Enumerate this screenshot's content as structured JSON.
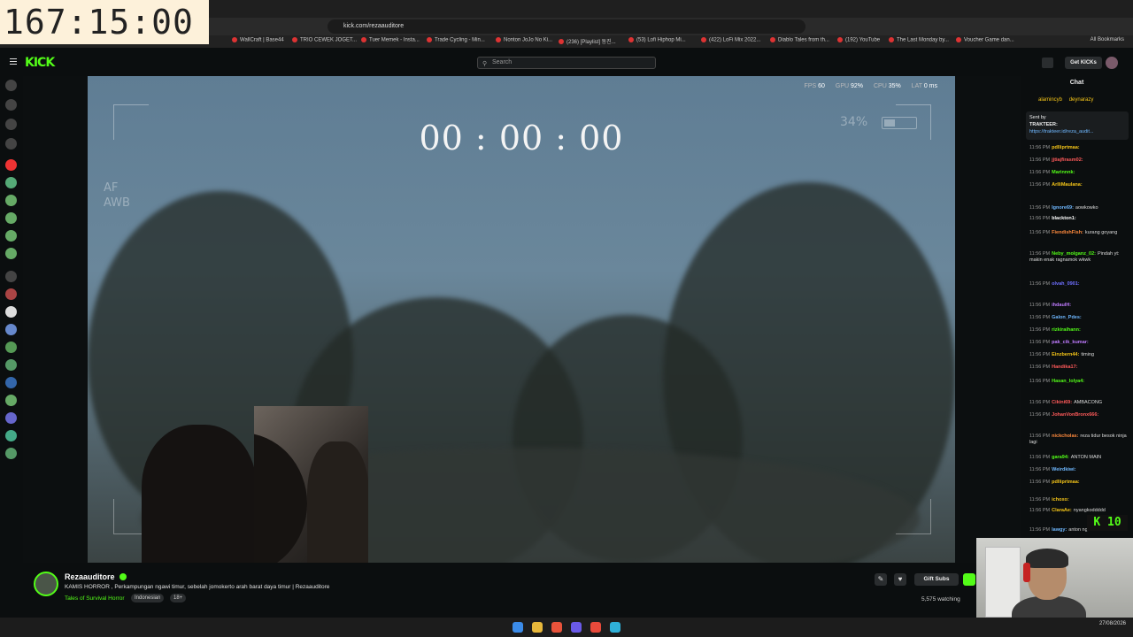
{
  "overlay_timer": "167:15:00",
  "browser": {
    "url": "kick.com/rezaauditore",
    "bookmarks": [
      "WallCraft | Base44",
      "TRIO CEWEK JOGET...",
      "Tuer Memek - Insta...",
      "Trade Cycling - Min...",
      "Nonton JoJo No Ki...",
      "(236) [Playlist] 동진...",
      "(53) Lofi Hiphop Mi...",
      "(422) LoFi Mix 2022...",
      "Diablo Tales from th...",
      "(192) YouTube",
      "The Last Monday by...",
      "Voucher Game dan..."
    ],
    "all_bookmarks": "All Bookmarks"
  },
  "header": {
    "logo": "KICK",
    "search_placeholder": "Search",
    "get_kicks": "Get KICKs"
  },
  "video": {
    "stream_timer": "00 : 00 : 00",
    "af_label": "AF",
    "awb_label": "AWB",
    "battery": "34%",
    "perf": {
      "fps_label": "FPS",
      "fps": "60",
      "gpu_label": "GPU",
      "gpu": "92%",
      "cpu_label": "CPU",
      "cpu": "35%",
      "lat_label": "LAT",
      "lat": "0 ms"
    }
  },
  "stream": {
    "streamer": "Rezaauditore",
    "title": "KAMIS HORROR , Perkampungan ngawi timur, sebelah jomokerto arah barat daya timur | Rezaauditore",
    "category": "Tales of Survival Horror",
    "tags": [
      "Indonesian",
      "18+"
    ],
    "gift_subs": "Gift Subs",
    "watching": "5,575 watching"
  },
  "chat": {
    "title": "Chat",
    "top_users": [
      "alamincyb",
      "deynarazy"
    ],
    "pinned": {
      "sent_by": "Sent by",
      "label": "TRAKTEER:",
      "link": "https://trakteer.id/reza_audit..."
    },
    "messages": [
      {
        "time": "11:56 PM",
        "user": "pdlliprtmaa:",
        "text": "",
        "color": "#f5c518"
      },
      {
        "time": "11:56 PM",
        "user": "jjtiajfirasm02:",
        "text": "",
        "color": "#ff5a5a"
      },
      {
        "time": "11:56 PM",
        "user": "Marinnnk:",
        "text": "",
        "color": "#53fc18"
      },
      {
        "time": "11:56 PM",
        "user": "ArlliMaulana:",
        "text": "",
        "color": "#f5c518"
      },
      {
        "time": "11:56 PM",
        "user": "Ignore69:",
        "text": "aowkowko",
        "color": "#6fb8ff"
      },
      {
        "time": "11:56 PM",
        "user": "blackton1:",
        "text": "",
        "color": "#ffffff"
      },
      {
        "time": "11:56 PM",
        "user": "FiendishFish:",
        "text": "kurang goyang",
        "color": "#ff8a3d"
      },
      {
        "time": "11:56 PM",
        "user": "Neby_molganz_02:",
        "text": "Pindah yt: makin enak ragnamok wkwk",
        "color": "#53fc18"
      },
      {
        "time": "11:56 PM",
        "user": "olvah_0901:",
        "text": "",
        "color": "#6f6fff"
      },
      {
        "time": "11:56 PM",
        "user": "ihdaulH:",
        "text": "",
        "color": "#c07bff"
      },
      {
        "time": "11:56 PM",
        "user": "Galon_Pdes:",
        "text": "",
        "color": "#6fb8ff"
      },
      {
        "time": "11:56 PM",
        "user": "rizkiraihann:",
        "text": "",
        "color": "#53fc18"
      },
      {
        "time": "11:56 PM",
        "user": "pak_cik_kumar:",
        "text": "",
        "color": "#c07bff"
      },
      {
        "time": "11:56 PM",
        "user": "Einzbern44:",
        "text": "timing",
        "color": "#f5c518"
      },
      {
        "time": "11:56 PM",
        "user": "Handika17:",
        "text": "",
        "color": "#ff5a5a"
      },
      {
        "time": "11:56 PM",
        "user": "Hasan_lolya4:",
        "text": "",
        "color": "#53fc18"
      },
      {
        "time": "11:56 PM",
        "user": "Cikini69:",
        "text": "AMBACONG",
        "color": "#ff5a5a"
      },
      {
        "time": "11:56 PM",
        "user": "JohanVonBronx666:",
        "text": "",
        "color": "#ff5a5a"
      },
      {
        "time": "11:56 PM",
        "user": "nickcholas:",
        "text": "reza tidur besok ninja lagi",
        "color": "#ff8a3d"
      },
      {
        "time": "11:56 PM",
        "user": "gara94:",
        "text": "ANTON MAIN",
        "color": "#53fc18"
      },
      {
        "time": "11:56 PM",
        "user": "Weirdkiwi:",
        "text": "",
        "color": "#6fb8ff"
      },
      {
        "time": "11:56 PM",
        "user": "pdlliprtmaa:",
        "text": "",
        "color": "#f5c518"
      },
      {
        "time": "11:56 PM",
        "user": "ichoxo:",
        "text": "",
        "color": "#f5c518"
      },
      {
        "time": "11:56 PM",
        "user": "ClaraAe:",
        "text": "nyangkoddddd",
        "color": "#f5c518"
      },
      {
        "time": "11:56 PM",
        "user": "lawgy:",
        "text": "anton ngemir",
        "color": "#6fb8ff"
      }
    ]
  },
  "overlay_counter": "K 10",
  "taskbar": {
    "date": "27/08/2026"
  }
}
